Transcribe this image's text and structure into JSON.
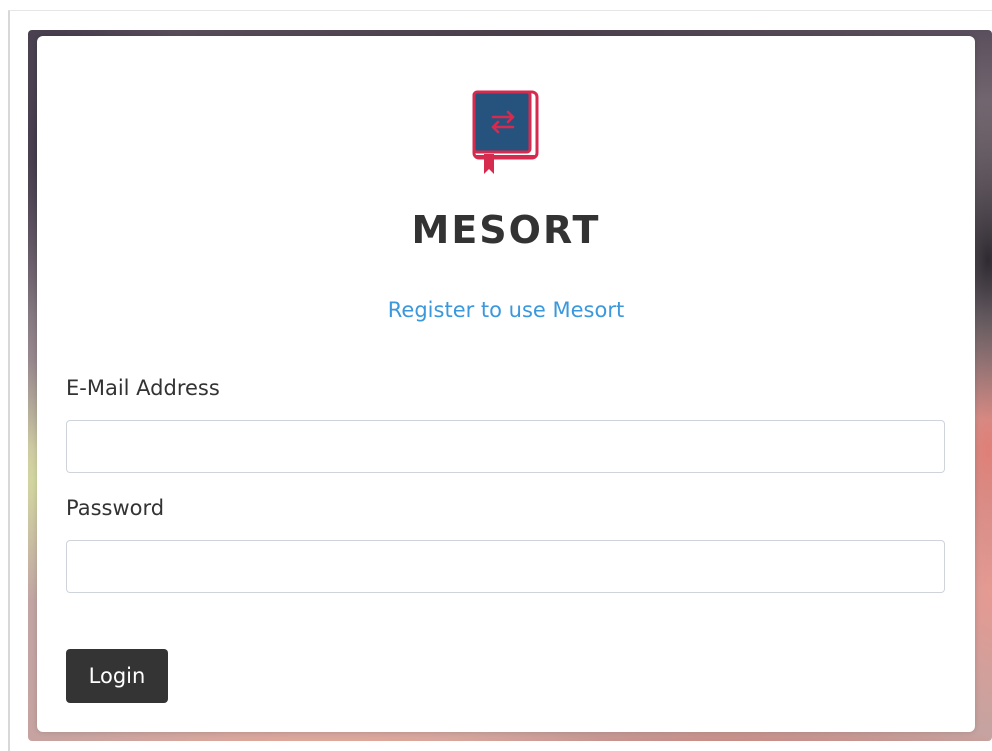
{
  "app": {
    "brand_name": "MESORT",
    "logo_icon": "book-swap-icon",
    "colors": {
      "logo_outline": "#d62b4f",
      "logo_fill": "#26527e",
      "link": "#3b98dc",
      "button_bg": "#343434",
      "text": "#333333"
    }
  },
  "login_form": {
    "register_link": "Register to use Mesort",
    "email_label": "E-Mail Address",
    "email_value": "",
    "password_label": "Password",
    "password_value": "",
    "login_label": "Login"
  }
}
